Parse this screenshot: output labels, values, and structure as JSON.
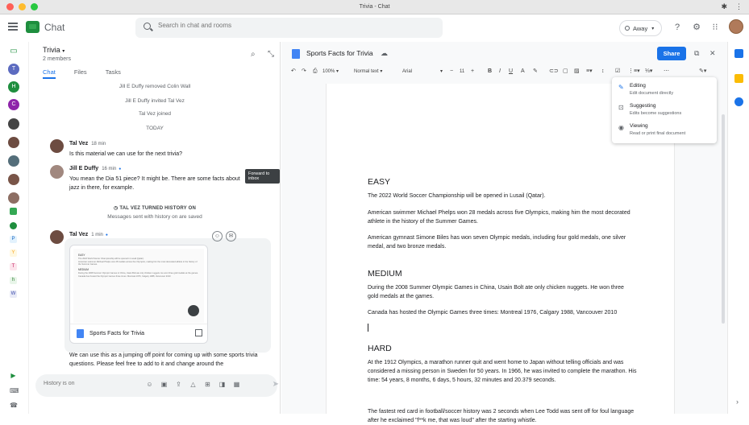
{
  "window": {
    "title": "Trivia - Chat"
  },
  "app": {
    "title": "Chat"
  },
  "search": {
    "placeholder": "Search in chat and rooms"
  },
  "status": {
    "label": "Away"
  },
  "room": {
    "name": "Trivia",
    "members": "2 members",
    "tabs": [
      "Chat",
      "Files",
      "Tasks"
    ]
  },
  "messages": {
    "sys1": "Jill E Duffy removed Colin Wall",
    "sys2": "Jill E Duffy invited Tal Vez",
    "sys3": "Tal Vez joined",
    "today": "TODAY",
    "m1": {
      "name": "Tal Vez",
      "time": "18 min",
      "text": "Is this material we can use for the next trivia?"
    },
    "m2": {
      "name": "Jill E Duffy",
      "time": "16 min",
      "text": "You mean the Dia 51 piece? It might be. There are some facts about jazz in there, for example."
    },
    "tooltip": "Forward to inbox",
    "history_title": "TAL VEZ TURNED HISTORY ON",
    "history_sub": "Messages sent with history on are saved",
    "m3": {
      "name": "Tal Vez",
      "time": "1 min",
      "text": "We can use this as a jumping off point for coming up with some sports trivia questions. Please feel free to add to it and change around the"
    },
    "card_name": "Sports Facts for Trivia"
  },
  "composer": {
    "placeholder": "History is on"
  },
  "doc": {
    "title": "Sports Facts for Trivia",
    "share": "Share",
    "toolbar": {
      "zoom": "100%",
      "style": "Normal text",
      "font": "Arial",
      "size": "11"
    },
    "easy": "EASY",
    "easy1": "The 2022 World Soccer Championship will be opened in Lusail (Qatar).",
    "easy2": "American swimmer Michael Phelps won 28 medals across five Olympics, making him the most decorated athlete in the history of the Summer Games.",
    "easy3": "American gymnast Simone Biles has won seven Olympic medals, including four gold medals, one silver medal, and two bronze medals.",
    "medium": "MEDIUM",
    "med1": "During the 2008 Summer Olympic Games in China, Usain Bolt ate only chicken nuggets. He won three gold medals at the games.",
    "med2": "Canada has hosted the Olympic Games three times: Montreal 1976, Calgary 1988, Vancouver 2010",
    "hard": "HARD",
    "hard1": "At the 1912 Olympics, a marathon runner quit and went home to Japan without telling officials and was considered a missing person in Sweden for 50 years. In 1966, he was invited to complete the marathon. His time: 54 years, 8 months, 6 days, 5 hours, 32 minutes and 20.379 seconds.",
    "hard2": "The fastest red card in football/soccer history was 2 seconds when Lee Todd was sent off for foul language after he exclaimed \"f**k me, that was loud\" after the starting whistle."
  },
  "modes": [
    {
      "title": "Editing",
      "sub": "Edit document directly"
    },
    {
      "title": "Suggesting",
      "sub": "Edits become suggestions"
    },
    {
      "title": "Viewing",
      "sub": "Read or print final document"
    }
  ],
  "colors": {
    "accent": "#1a73e8",
    "chat_green": "#1e8e3e"
  }
}
